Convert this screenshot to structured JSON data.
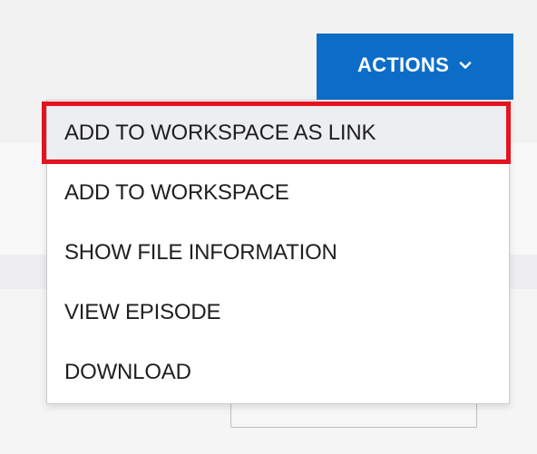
{
  "actions_button": {
    "label": "ACTIONS",
    "icon": "chevron-down-icon",
    "color": "#0b6dc8"
  },
  "menu": {
    "items": [
      {
        "label": "ADD TO WORKSPACE AS LINK",
        "highlighted": true
      },
      {
        "label": "ADD TO WORKSPACE"
      },
      {
        "label": "SHOW FILE INFORMATION"
      },
      {
        "label": "VIEW EPISODE"
      },
      {
        "label": "DOWNLOAD"
      }
    ]
  },
  "annotation": {
    "highlight_color": "#e3141f"
  }
}
